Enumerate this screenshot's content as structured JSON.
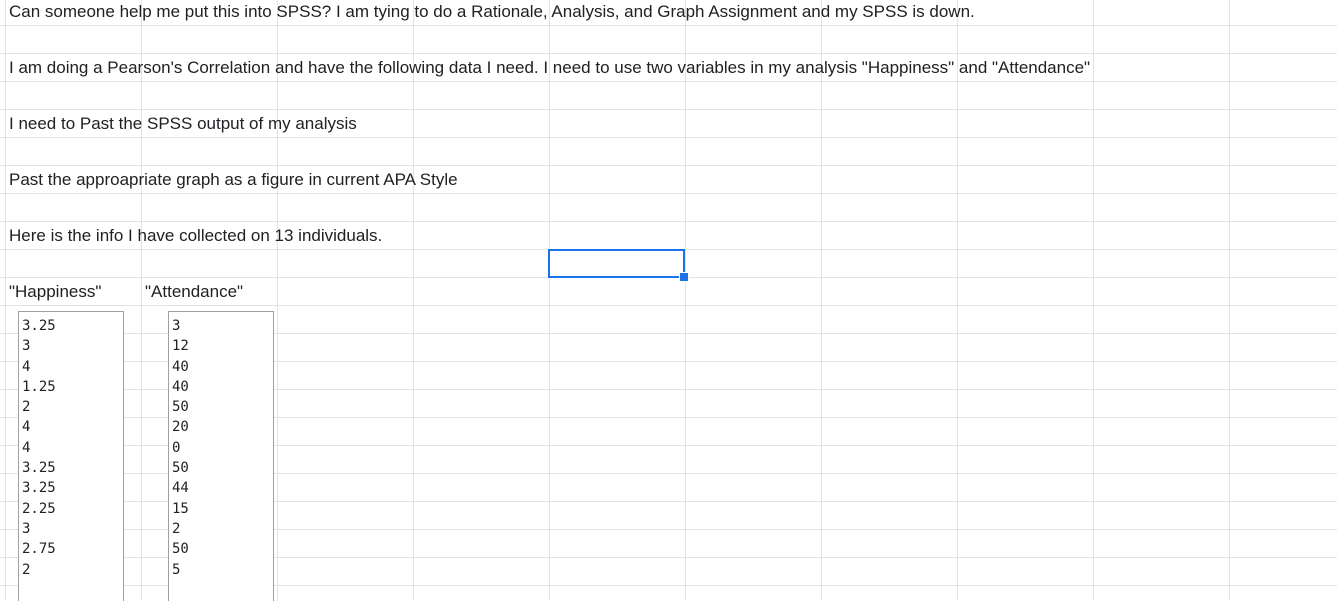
{
  "sheet": {
    "rows": [
      "Can someone help me put this into SPSS? I am tying to do a Rationale, Analysis, and Graph Assignment and my SPSS is down.",
      "I am doing a Pearson's Correlation and have the following data I need. I need to use two variables in my analysis \"Happiness\" and \"Attendance\"",
      "I need to Past the SPSS output of my analysis",
      "Past the approapriate graph as a figure in current APA Style",
      "Here is the info I have collected on 13 individuals."
    ],
    "headers": {
      "happiness": "\"Happiness\"",
      "attendance": "\"Attendance\""
    },
    "happiness_values": [
      "3.25",
      "3",
      "4",
      "1.25",
      "2",
      "4",
      "4",
      "3.25",
      "3.25",
      "2.25",
      "3",
      "2.75",
      "2"
    ],
    "attendance_values": [
      "3",
      "12",
      "40",
      "40",
      "50",
      "20",
      "0",
      "50",
      "44",
      "15",
      "2",
      "50",
      "5"
    ]
  },
  "colors": {
    "selection": "#1a73e8",
    "gridline": "#e2e3e3"
  }
}
